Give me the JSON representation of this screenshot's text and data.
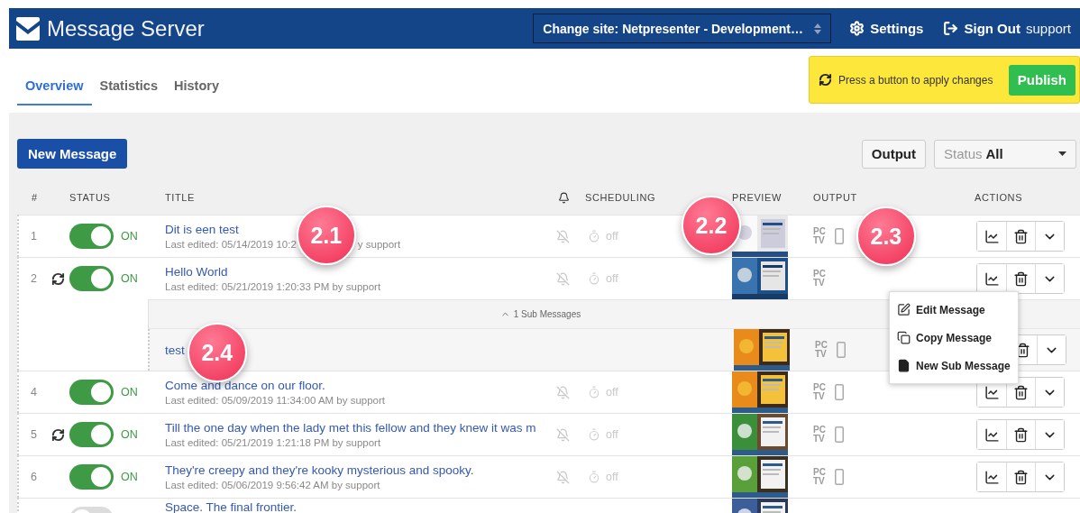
{
  "header": {
    "app_name": "Message Server",
    "site_select": "Change site: Netpresenter - Development…",
    "settings": "Settings",
    "sign_out": "Sign Out",
    "user": "support"
  },
  "tabs": [
    {
      "label": "Overview",
      "selected": true
    },
    {
      "label": "Statistics",
      "selected": false
    },
    {
      "label": "History",
      "selected": false
    }
  ],
  "notice": {
    "text": "Press a button to apply changes",
    "button": "Publish"
  },
  "toolbar": {
    "new_button": "New Message",
    "output_button": "Output",
    "status_filter": {
      "label": "Status",
      "value": "All"
    }
  },
  "table": {
    "columns": [
      "#",
      "STATUS",
      "TITLE",
      "SCHEDULING",
      "PREVIEW",
      "OUTPUT",
      "ACTIONS"
    ],
    "rows": [
      {
        "kind": "message",
        "number": "1",
        "sync": false,
        "on": true,
        "status_label": "ON",
        "title": "Dit is een test",
        "meta": "Last edited: 05/14/2019 10:2",
        "meta_tail": "y support",
        "scheduling": "off",
        "output": {
          "pc": "PC",
          "tv": "TV",
          "mobile": true
        },
        "meta_badge": "2.1",
        "preview_badge": "2.2",
        "output_badge": "2.3"
      },
      {
        "kind": "message",
        "number": "2",
        "sync": true,
        "on": true,
        "status_label": "ON",
        "title": "Hello World",
        "meta": "Last edited: 05/21/2019 1:20:33 PM by support",
        "scheduling": "off",
        "output": {
          "pc": "PC",
          "tv": "TV",
          "mobile": false
        },
        "sub_messages": {
          "label": "1 Sub Messages",
          "expanded": true,
          "items": [
            {
              "title": "test",
              "output": {
                "pc": "PC",
                "tv": "TV",
                "mobile": true
              },
              "title_badge": "2.4"
            }
          ]
        }
      },
      {
        "kind": "message",
        "number": "4",
        "sync": false,
        "on": true,
        "status_label": "ON",
        "title": "Come and dance on our floor.",
        "meta": "Last edited: 05/09/2019 11:34:00 AM by support",
        "scheduling": "off",
        "output": {
          "pc": "PC",
          "tv": "TV",
          "mobile": true
        }
      },
      {
        "kind": "message",
        "number": "5",
        "sync": true,
        "on": true,
        "status_label": "ON",
        "title": "Till the one day when the lady met this fellow and they knew it was m",
        "meta": "Last edited: 05/21/2019 1:21:18 PM by support",
        "scheduling": "off",
        "output": {
          "pc": "PC",
          "tv": "TV",
          "mobile": true
        }
      },
      {
        "kind": "message",
        "number": "6",
        "sync": false,
        "on": true,
        "status_label": "ON",
        "title": "They're creepy and they're kooky mysterious and spooky.",
        "meta": "Last edited: 05/06/2019 9:56:42 AM by support",
        "scheduling": "off",
        "output": {
          "pc": "PC",
          "tv": "TV",
          "mobile": true
        }
      },
      {
        "kind": "partial",
        "on": false,
        "title": "Space. The final frontier."
      }
    ]
  },
  "menu": {
    "items": [
      {
        "kind": "edit",
        "label": "Edit Message"
      },
      {
        "kind": "copy",
        "label": "Copy Message"
      },
      {
        "kind": "new",
        "label": "New Sub Message"
      }
    ]
  }
}
